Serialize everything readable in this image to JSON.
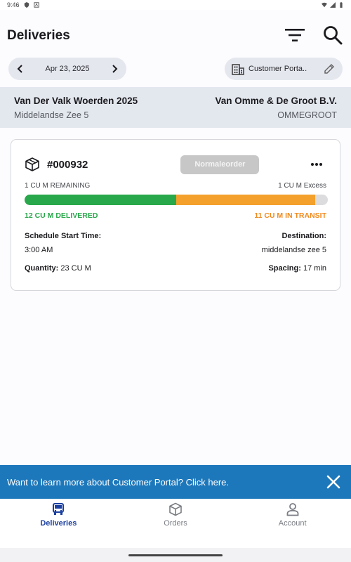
{
  "status_bar": {
    "time": "9:46"
  },
  "header": {
    "title": "Deliveries"
  },
  "controls": {
    "date": "Apr 23, 2025",
    "portal": "Customer Porta.."
  },
  "project": {
    "name": "Van Der Valk Woerden 2025",
    "address": "Middelandse Zee 5",
    "company": "Van Omme & De Groot B.V.",
    "company_code": "OMMEGROOT"
  },
  "delivery": {
    "order_number": "#000932",
    "order_type": "Normaleorder",
    "remaining": "1 CU M REMAINING",
    "excess": "1 CU M Excess",
    "delivered_label": "12 CU M DELIVERED",
    "in_transit_label": "11 CU M IN TRANSIT",
    "progress": {
      "delivered": 12,
      "in_transit": 11,
      "total": 24
    },
    "schedule_label": "Schedule Start Time:",
    "schedule_value": "3:00 AM",
    "destination_label": "Destination:",
    "destination_value": "middelandse zee 5",
    "quantity_label": "Quantity:",
    "quantity_value": "23 CU M",
    "spacing_label": "Spacing:",
    "spacing_value": "17 min"
  },
  "promo": {
    "text": "Want to learn more about Customer Portal? Click here."
  },
  "nav": {
    "items": [
      {
        "label": "Deliveries",
        "icon": "truck-icon",
        "active": true
      },
      {
        "label": "Orders",
        "icon": "box-icon",
        "active": false
      },
      {
        "label": "Account",
        "icon": "person-icon",
        "active": false
      }
    ]
  },
  "colors": {
    "delivered": "#29a84b",
    "in_transit": "#f3a12c",
    "banner": "#1d78bb",
    "active_nav": "#1b3fa0"
  }
}
